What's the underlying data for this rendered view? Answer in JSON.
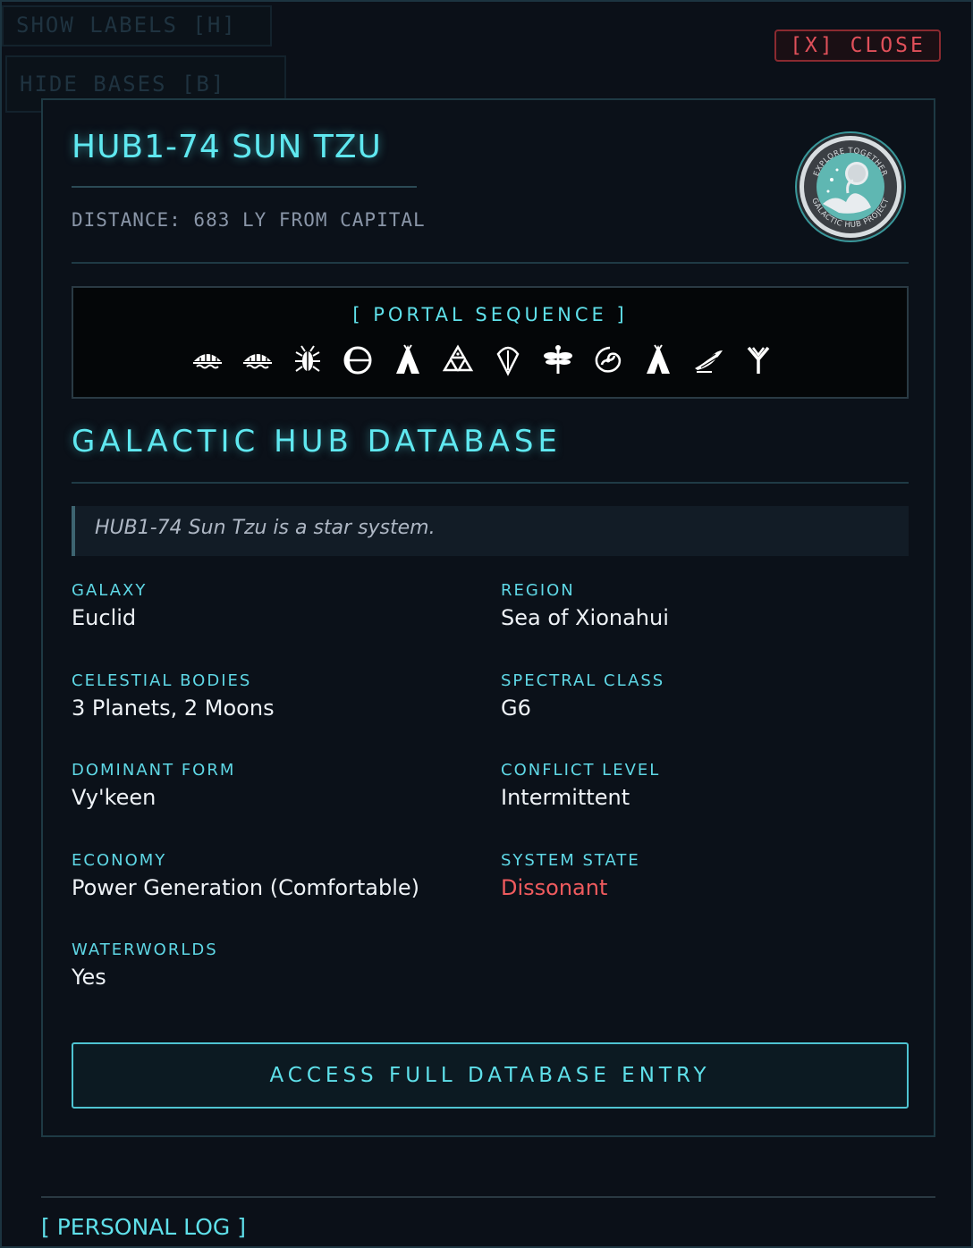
{
  "background": {
    "show_labels": "SHOW LABELS [H]",
    "hide_bases": "HIDE BASES [B]"
  },
  "close_label": "[X] CLOSE",
  "system": {
    "title": "HUB1-74 SUN TZU",
    "distance": "DISTANCE: 683 LY FROM CAPITAL"
  },
  "badge": {
    "top_text": "EXPLORE TOGETHER",
    "bottom_text": "GALACTIC HUB PROJECT"
  },
  "portal": {
    "title": "[ PORTAL SEQUENCE ]",
    "glyphs": [
      "boat-glyph",
      "boat-glyph",
      "bug-glyph",
      "eclipse-glyph",
      "tent-glyph",
      "triangles-glyph",
      "leaf-glyph",
      "dragonfly-glyph",
      "galaxy-glyph",
      "tent-glyph",
      "bird-glyph",
      "antenna-glyph"
    ]
  },
  "database": {
    "title": "GALACTIC HUB DATABASE",
    "description": "HUB1-74 Sun Tzu is a star system.",
    "fields": {
      "galaxy": {
        "label": "GALAXY",
        "value": "Euclid"
      },
      "region": {
        "label": "REGION",
        "value": "Sea of Xionahui"
      },
      "celestial": {
        "label": "CELESTIAL BODIES",
        "value": "3 Planets, 2 Moons"
      },
      "spectral": {
        "label": "SPECTRAL CLASS",
        "value": "G6"
      },
      "dominant": {
        "label": "DOMINANT FORM",
        "value": "Vy'keen"
      },
      "conflict": {
        "label": "CONFLICT LEVEL",
        "value": "Intermittent"
      },
      "economy": {
        "label": "ECONOMY",
        "value": "Power Generation (Comfortable)"
      },
      "state": {
        "label": "SYSTEM STATE",
        "value": "Dissonant"
      },
      "waterworlds": {
        "label": "WATERWORLDS",
        "value": "Yes"
      }
    },
    "access_label": "ACCESS FULL DATABASE ENTRY"
  },
  "personal_log": "[ PERSONAL LOG ]",
  "colors": {
    "accent": "#5fe8f0",
    "danger": "#ef5b5e",
    "close": "#e0505a",
    "panel_bg": "#0b1119"
  }
}
